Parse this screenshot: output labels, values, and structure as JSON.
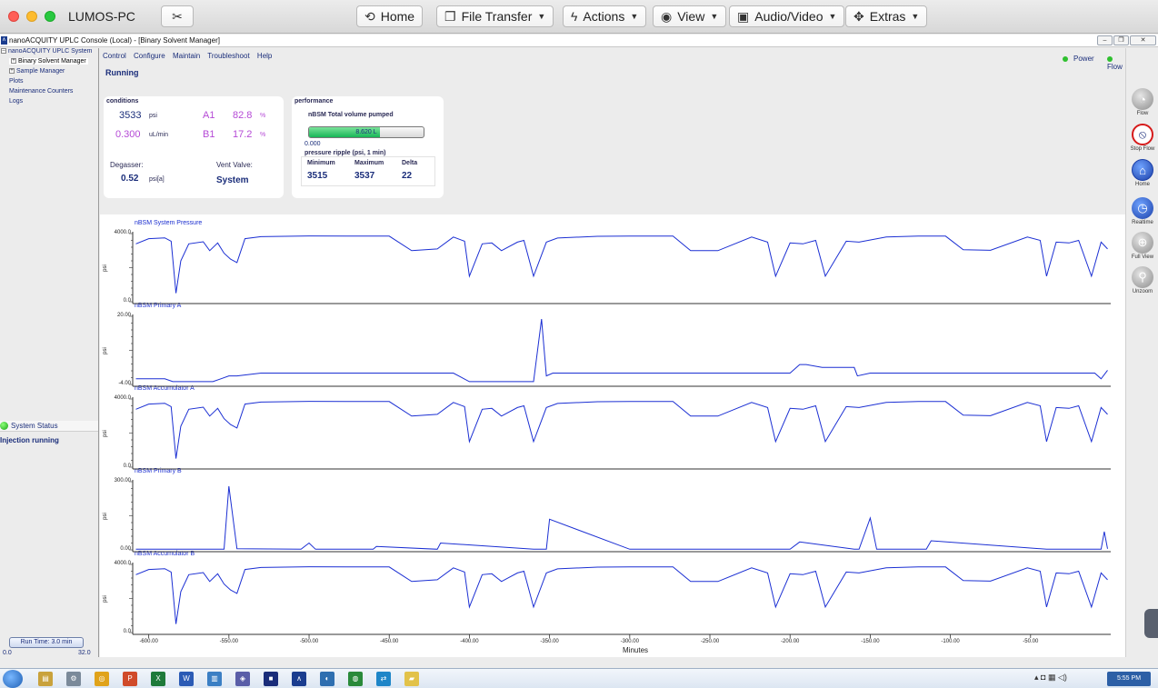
{
  "mac": {
    "machine": "LUMOS-PC",
    "buttons": {
      "home": "Home",
      "file_transfer": "File Transfer",
      "actions": "Actions",
      "view": "View",
      "audio_video": "Audio/Video",
      "extras": "Extras"
    }
  },
  "window": {
    "title": "nanoACQUITY UPLC Console (Local) - [Binary Solvent Manager]"
  },
  "tree": {
    "items": [
      "nanoACQUITY UPLC System",
      "Binary Solvent Manager",
      "Sample Manager",
      "Plots",
      "Maintenance Counters",
      "Logs"
    ]
  },
  "status": {
    "heading": "System Status",
    "text": "Injection running",
    "run_time": "Run Time: 3.0 min",
    "run_min": "0.0",
    "run_max": "32.0"
  },
  "menu": [
    "Control",
    "Configure",
    "Maintain",
    "Troubleshoot",
    "Help"
  ],
  "state": "Running",
  "indicators": {
    "power": "Power",
    "flow": "Flow"
  },
  "conditions": {
    "title": "conditions",
    "pressure": "3533",
    "pressure_unit": "psi",
    "flow": "0.300",
    "flow_unit": "uL/min",
    "a1_label": "A1",
    "a1_value": "82.8",
    "b1_label": "B1",
    "b1_value": "17.2",
    "pct": "%",
    "degasser_label": "Degasser:",
    "degasser_value": "0.52",
    "degasser_unit": "psi[a]",
    "vent_label": "Vent Valve:",
    "vent_value": "System"
  },
  "performance": {
    "title": "performance",
    "total_label": "nBSM Total volume pumped",
    "volume_text": "8.620 L",
    "volume_fraction": 0.62,
    "volume_min": "0.000",
    "ripple_title": "pressure ripple (psi, 1 min)",
    "min_label": "Minimum",
    "max_label": "Maximum",
    "delta_label": "Delta",
    "min_value": "3515",
    "max_value": "3537",
    "delta_value": "22"
  },
  "colors": {
    "trace": "#1b2fd3",
    "accent": "#1a2d7a",
    "gradient_pct": "#b54ad6"
  },
  "plots": {
    "x_label": "Minutes",
    "x_ticks": [
      "-600.00",
      "-550.00",
      "-500.00",
      "-450.00",
      "-400.00",
      "-350.00",
      "-300.00",
      "-250.00",
      "-200.00",
      "-150.00",
      "-100.00",
      "-50.00"
    ],
    "y_unit": "psi",
    "panels": [
      {
        "title": "nBSM System Pressure",
        "ymax_label": "4000.0",
        "ymin_label": "0.0"
      },
      {
        "title": "nBSM Primary A",
        "ymax_label": "20.00",
        "ymin_label": "-4.00"
      },
      {
        "title": "nBSM Accumulator A",
        "ymax_label": "4000.0",
        "ymin_label": "0.0"
      },
      {
        "title": "nBSM Primary B",
        "ymax_label": "300.00",
        "ymin_label": "0.00"
      },
      {
        "title": "nBSM Accumulator B",
        "ymax_label": "4000.0",
        "ymin_label": "0.0"
      }
    ]
  },
  "chart_data": [
    {
      "type": "line",
      "title": "nBSM System Pressure",
      "ylabel": "psi",
      "xlabel": "Minutes",
      "xlim": [
        -610,
        0
      ],
      "ylim": [
        0,
        4000
      ],
      "series": [
        {
          "x": [
            -608,
            -600,
            -590,
            -586,
            -583,
            -580,
            -575,
            -566,
            -562,
            -557,
            -553,
            -549,
            -545,
            -540,
            -530,
            -500,
            -450,
            -436,
            -420,
            -410,
            -403,
            -400,
            -392,
            -386,
            -380,
            -370,
            -366,
            -360,
            -352,
            -345,
            -320,
            -300,
            -273,
            -262,
            -245,
            -224,
            -214,
            -209,
            -200,
            -192,
            -184,
            -178,
            -165,
            -157,
            -140,
            -120,
            -103,
            -92,
            -75,
            -52,
            -44,
            -40,
            -34,
            -26,
            -20,
            -12,
            -6,
            -2
          ],
          "y": [
            3400,
            3700,
            3750,
            3550,
            500,
            2400,
            3400,
            3520,
            3000,
            3450,
            2850,
            2500,
            2300,
            3700,
            3820,
            3860,
            3850,
            3000,
            3100,
            3800,
            3550,
            1500,
            3400,
            3450,
            3000,
            3500,
            3600,
            1500,
            3500,
            3740,
            3840,
            3850,
            3850,
            3000,
            3000,
            3800,
            3500,
            1500,
            3450,
            3400,
            3600,
            1500,
            3550,
            3500,
            3800,
            3850,
            3850,
            3050,
            3020,
            3800,
            3600,
            1500,
            3500,
            3450,
            3600,
            1500,
            3500,
            3100
          ]
        }
      ]
    },
    {
      "type": "line",
      "title": "nBSM Primary A",
      "ylabel": "psi",
      "xlabel": "Minutes",
      "xlim": [
        -610,
        0
      ],
      "ylim": [
        -4,
        20
      ],
      "series": [
        {
          "x": [
            -608,
            -590,
            -585,
            -570,
            -560,
            -555,
            -550,
            -545,
            -530,
            -500,
            -450,
            -410,
            -400,
            -390,
            -380,
            -370,
            -360,
            -355,
            -352,
            -348,
            -340,
            -300,
            -250,
            -200,
            -194,
            -190,
            -180,
            -170,
            -160,
            -158,
            -150,
            -100,
            -50,
            -10,
            -6,
            -2
          ],
          "y": [
            -2,
            -2,
            -3,
            -3,
            -3,
            -2,
            -1,
            -1,
            0,
            0,
            0,
            0,
            -3,
            -3,
            -3,
            -3,
            -3,
            19,
            -1,
            0,
            0,
            0,
            0,
            0,
            3,
            3,
            2,
            2,
            2,
            -1,
            0,
            0,
            0,
            0,
            -2,
            1
          ]
        }
      ]
    },
    {
      "type": "line",
      "title": "nBSM Accumulator A",
      "ylabel": "psi",
      "xlabel": "Minutes",
      "xlim": [
        -610,
        0
      ],
      "ylim": [
        0,
        4000
      ],
      "series": [
        {
          "x": [
            -608,
            -600,
            -590,
            -586,
            -583,
            -580,
            -575,
            -566,
            -562,
            -557,
            -553,
            -549,
            -545,
            -540,
            -530,
            -500,
            -450,
            -436,
            -420,
            -410,
            -403,
            -400,
            -392,
            -386,
            -380,
            -370,
            -366,
            -360,
            -352,
            -345,
            -320,
            -300,
            -273,
            -262,
            -245,
            -224,
            -214,
            -209,
            -200,
            -192,
            -184,
            -178,
            -165,
            -157,
            -140,
            -120,
            -103,
            -92,
            -75,
            -52,
            -44,
            -40,
            -34,
            -26,
            -20,
            -12,
            -6,
            -2
          ],
          "y": [
            3400,
            3700,
            3750,
            3550,
            500,
            2400,
            3400,
            3520,
            3000,
            3450,
            2850,
            2500,
            2300,
            3700,
            3820,
            3860,
            3850,
            3000,
            3100,
            3800,
            3550,
            1500,
            3400,
            3450,
            3000,
            3500,
            3600,
            1500,
            3500,
            3740,
            3840,
            3850,
            3850,
            3000,
            3000,
            3800,
            3500,
            1500,
            3450,
            3400,
            3600,
            1500,
            3550,
            3500,
            3800,
            3850,
            3850,
            3050,
            3020,
            3800,
            3600,
            1500,
            3500,
            3450,
            3600,
            1500,
            3500,
            3100
          ]
        }
      ]
    },
    {
      "type": "line",
      "title": "nBSM Primary B",
      "ylabel": "psi",
      "xlabel": "Minutes",
      "xlim": [
        -610,
        0
      ],
      "ylim": [
        0,
        300
      ],
      "series": [
        {
          "x": [
            -608,
            -560,
            -553,
            -550,
            -545,
            -505,
            -500,
            -496,
            -460,
            -458,
            -420,
            -418,
            -360,
            -352,
            -350,
            -300,
            -290,
            -270,
            -256,
            -200,
            -194,
            -160,
            -157,
            -150,
            -146,
            -115,
            -112,
            -40,
            -37,
            -6,
            -4,
            -2
          ],
          "y": [
            3,
            3,
            3,
            280,
            5,
            3,
            30,
            3,
            3,
            15,
            3,
            30,
            3,
            3,
            135,
            3,
            3,
            3,
            3,
            3,
            35,
            3,
            3,
            140,
            3,
            3,
            40,
            3,
            3,
            3,
            80,
            5
          ]
        }
      ]
    },
    {
      "type": "line",
      "title": "nBSM Accumulator B",
      "ylabel": "psi",
      "xlabel": "Minutes",
      "xlim": [
        -610,
        0
      ],
      "ylim": [
        0,
        4000
      ],
      "series": [
        {
          "x": [
            -608,
            -600,
            -590,
            -586,
            -583,
            -580,
            -575,
            -566,
            -562,
            -557,
            -553,
            -549,
            -545,
            -540,
            -530,
            -500,
            -450,
            -436,
            -420,
            -410,
            -403,
            -400,
            -392,
            -386,
            -380,
            -370,
            -366,
            -360,
            -352,
            -345,
            -320,
            -300,
            -273,
            -262,
            -245,
            -224,
            -214,
            -209,
            -200,
            -192,
            -184,
            -178,
            -165,
            -157,
            -140,
            -120,
            -103,
            -92,
            -75,
            -52,
            -44,
            -40,
            -34,
            -26,
            -20,
            -12,
            -6,
            -2
          ],
          "y": [
            3400,
            3700,
            3750,
            3550,
            500,
            2400,
            3400,
            3520,
            3000,
            3450,
            2850,
            2500,
            2300,
            3700,
            3820,
            3860,
            3850,
            3000,
            3100,
            3800,
            3550,
            1500,
            3400,
            3450,
            3000,
            3500,
            3600,
            1500,
            3500,
            3740,
            3840,
            3850,
            3850,
            3000,
            3000,
            3800,
            3500,
            1500,
            3450,
            3400,
            3600,
            1500,
            3550,
            3500,
            3800,
            3850,
            3850,
            3050,
            3020,
            3800,
            3600,
            1500,
            3500,
            3450,
            3600,
            1500,
            3500,
            3100
          ]
        }
      ]
    }
  ],
  "toolbar": {
    "flow": "Flow",
    "stop_flow": "Stop Flow",
    "home": "Home",
    "realtime": "Realtime",
    "full_view": "Full View",
    "unzoom": "Unzoom"
  },
  "taskbar": {
    "time": "5:55 PM"
  }
}
